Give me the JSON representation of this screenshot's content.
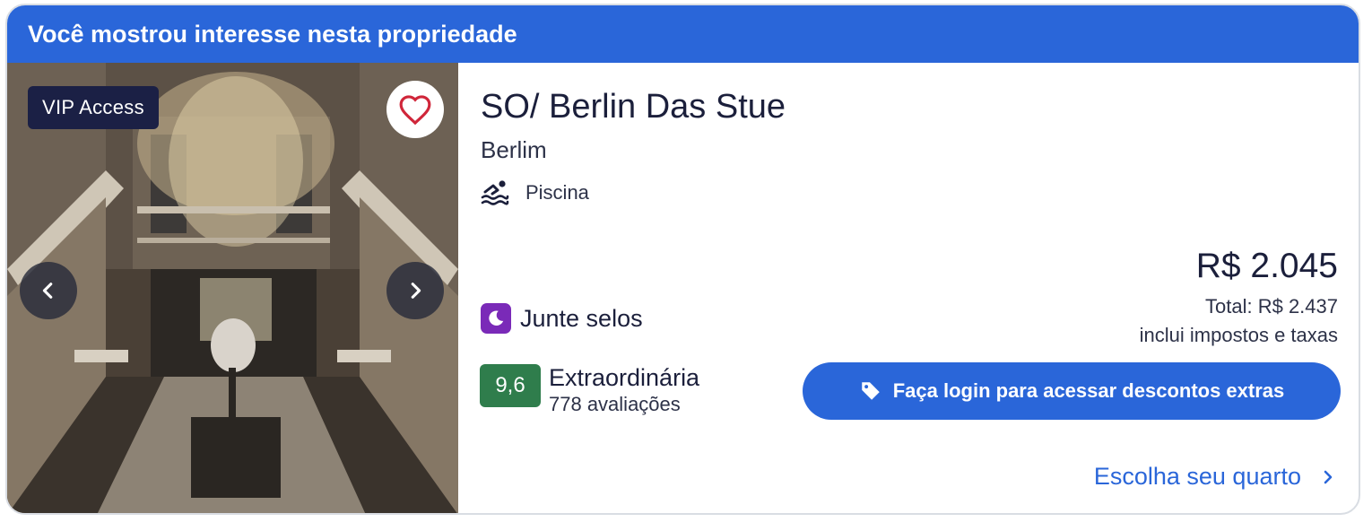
{
  "banner": {
    "text": "Você mostrou interesse nesta propriedade"
  },
  "gallery": {
    "badge": "VIP Access"
  },
  "hotel": {
    "name": "SO/ Berlin Das Stue",
    "city": "Berlim",
    "amenity": {
      "label": "Piscina",
      "icon": "swimming-pool-icon"
    }
  },
  "loyalty": {
    "label": "Junte selos",
    "icon": "moon-icon"
  },
  "rating": {
    "score": "9,6",
    "label": "Extraordinária",
    "count": "778 avaliações"
  },
  "price": {
    "main": "R$ 2.045",
    "total": "Total: R$ 2.437",
    "note": "inclui impostos e taxas"
  },
  "actions": {
    "login_label": "Faça login para acessar descontos extras",
    "choose_room_label": "Escolha seu quarto"
  },
  "colors": {
    "brand_blue": "#2a66d9",
    "vip_badge_bg": "#1b2045",
    "rating_green": "#2f7d4c",
    "loyalty_purple": "#7a2ab8",
    "favorite_heart": "#d0263a"
  }
}
